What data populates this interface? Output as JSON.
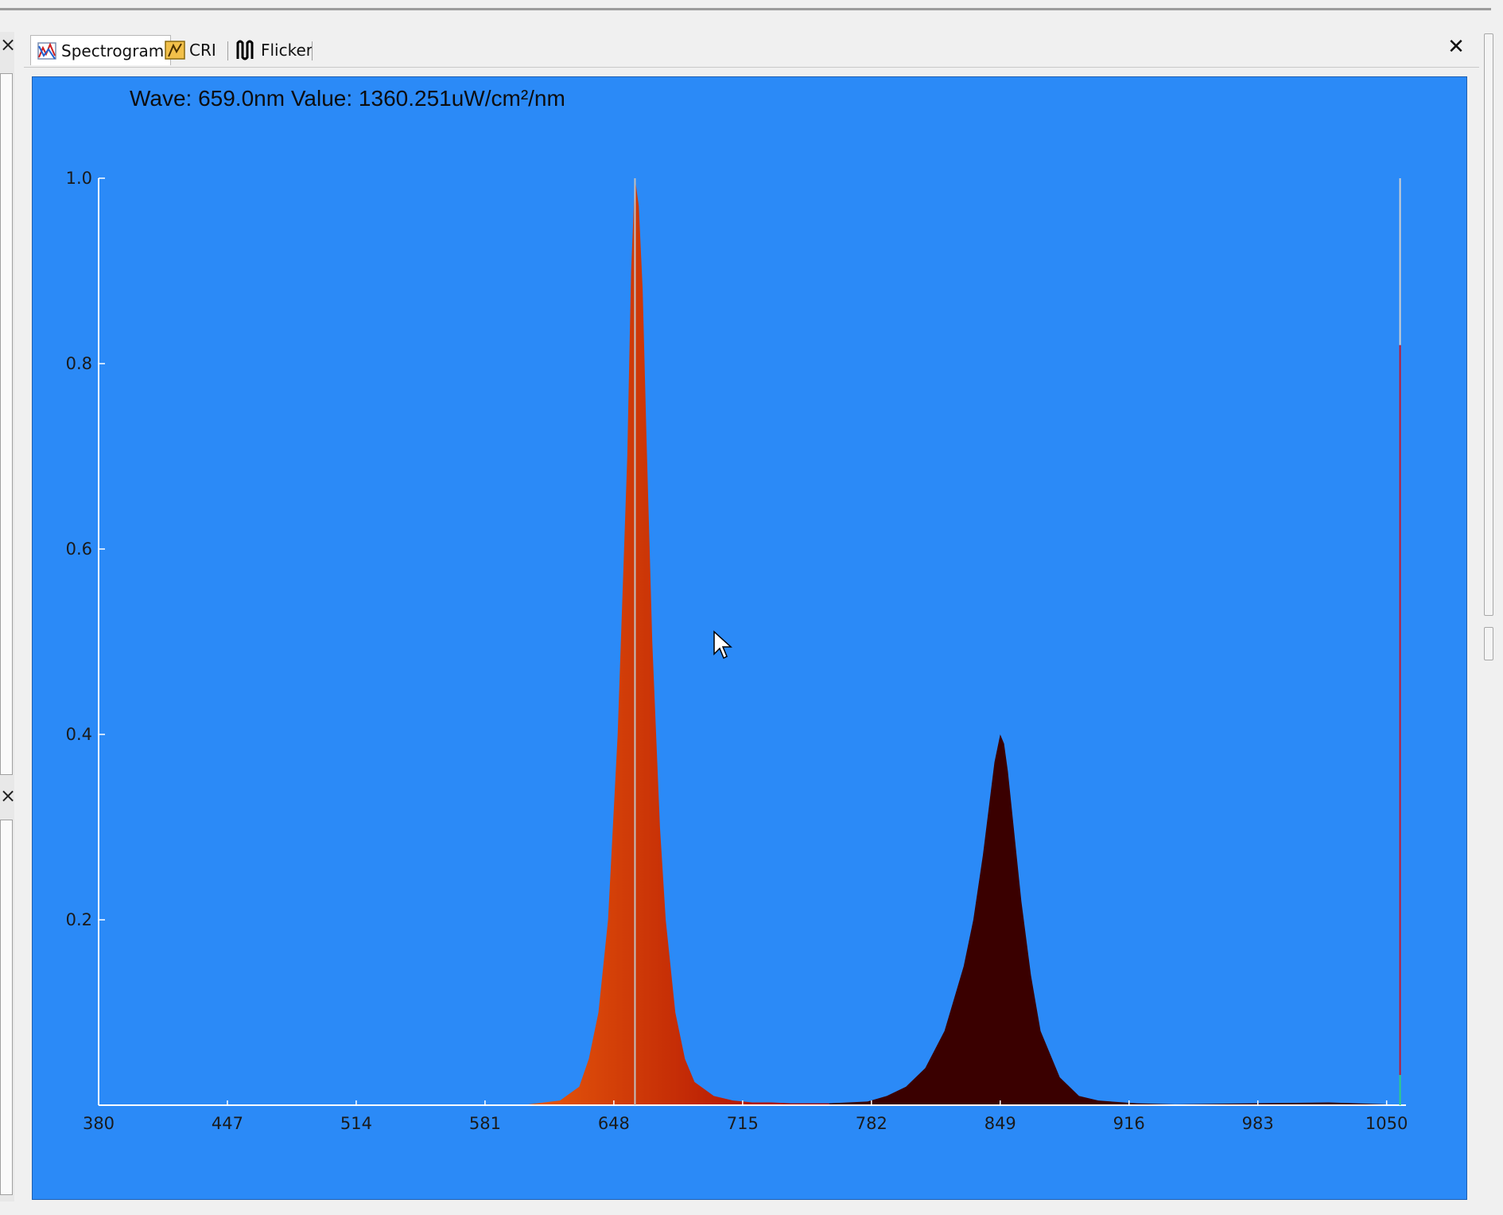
{
  "tabs": [
    {
      "label": "Spectrogram",
      "icon": "spectrogram-icon",
      "active": true
    },
    {
      "label": "CRI",
      "icon": "cri-icon",
      "active": false
    },
    {
      "label": "Flicker",
      "icon": "flicker-icon",
      "active": false
    }
  ],
  "readout": {
    "text": "Wave: 659.0nm Value: 1360.251uW/cm²/nm"
  },
  "colors": {
    "plot_background": "#2b8af7",
    "axis": "#ffffff",
    "peak1_low": "#e85b0c",
    "peak1_high": "#a30000",
    "peak2": "#3a0000",
    "marker": "#c0c0c0"
  },
  "chart_data": {
    "type": "area",
    "title": "",
    "xlabel": "",
    "ylabel": "",
    "xlim": [
      380,
      1058
    ],
    "ylim": [
      0,
      1.0
    ],
    "x_ticks": [
      380,
      447,
      514,
      581,
      648,
      715,
      782,
      849,
      916,
      983,
      1050
    ],
    "x_tick_labels": [
      "380",
      "447",
      "514",
      "581",
      "648",
      "715",
      "782",
      "849",
      "916",
      "983",
      "1050"
    ],
    "y_ticks": [
      0.2,
      0.4,
      0.6,
      0.8,
      1.0
    ],
    "y_tick_labels": [
      "0.2",
      "0.4",
      "0.6",
      "0.8",
      "1.0"
    ],
    "grid": false,
    "cursor_wavelength": 659.0,
    "cursor_value": "1360.251uW/cm²/nm",
    "series": [
      {
        "x": [
          600,
          620,
          630,
          635,
          640,
          645,
          650,
          655,
          657,
          659,
          661,
          663,
          665,
          668,
          672,
          675,
          680,
          685,
          690,
          700,
          710,
          720,
          730,
          740,
          760,
          780,
          790,
          800,
          810,
          820,
          830,
          835,
          840,
          843,
          846,
          849,
          851,
          853,
          856,
          860,
          865,
          870,
          880,
          890,
          900,
          920,
          940,
          980,
          1020,
          1050
        ],
        "y": [
          0.0,
          0.005,
          0.02,
          0.05,
          0.1,
          0.2,
          0.4,
          0.7,
          0.9,
          1.0,
          0.97,
          0.88,
          0.72,
          0.5,
          0.3,
          0.2,
          0.1,
          0.05,
          0.025,
          0.01,
          0.005,
          0.003,
          0.003,
          0.002,
          0.002,
          0.004,
          0.01,
          0.02,
          0.04,
          0.08,
          0.15,
          0.2,
          0.27,
          0.32,
          0.37,
          0.4,
          0.39,
          0.36,
          0.3,
          0.22,
          0.14,
          0.08,
          0.03,
          0.01,
          0.005,
          0.002,
          0.001,
          0.002,
          0.003,
          0.001
        ]
      }
    ],
    "reference_line": {
      "x": 1057,
      "y": 0.82
    }
  }
}
